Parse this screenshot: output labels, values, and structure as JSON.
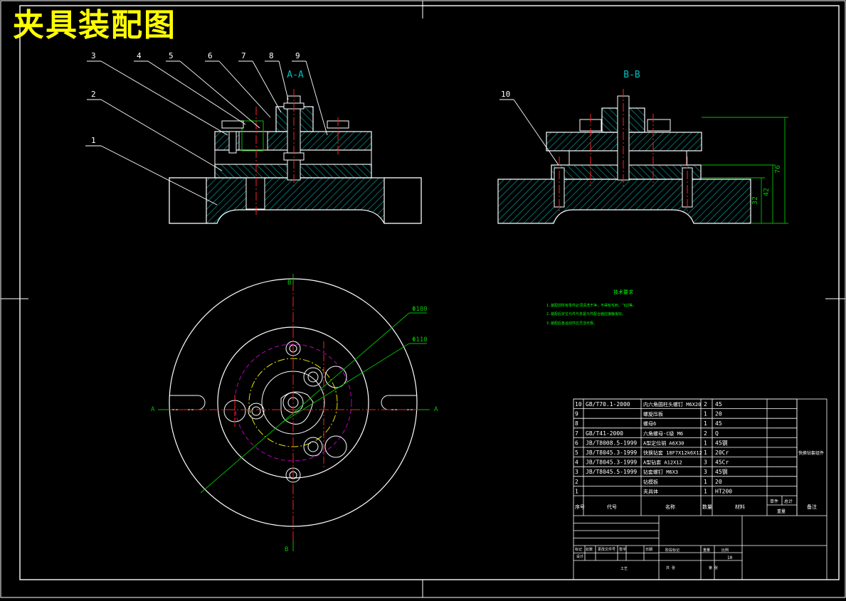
{
  "title": "夹具装配图",
  "colors": {
    "background": "#000000",
    "outline": "#ffffff",
    "title": "#ffff00",
    "hatch": "#00b3b3",
    "center_line": "#ff2020",
    "dimension": "#00c000",
    "tech_notes": "#00ff00",
    "pitch_circle": "#c000c0",
    "arc_yellow": "#e6e600"
  },
  "section_aa": {
    "label": "A-A"
  },
  "section_bb": {
    "label": "B-B"
  },
  "balloons": {
    "b1": "1",
    "b2": "2",
    "b3": "3",
    "b4": "4",
    "b5": "5",
    "b6": "6",
    "b7": "7",
    "b8": "8",
    "b9": "9",
    "b10": "10"
  },
  "dimensions": {
    "d1": "76",
    "d2": "42",
    "d3": "32",
    "dia1": "Φ180",
    "dia2": "Φ110"
  },
  "cut_marks": {
    "a_left": "A",
    "a_right": "A",
    "b_top": "B",
    "b_bottom": "B"
  },
  "tech_notes": {
    "title": "技术要求",
    "lines": [
      "1.装配前所有零件必须清洗干净，不得有毛刺、飞边等。",
      "2.装配后定位元件与夹紧元件配合面应接触良好。",
      "3.装配后各运动件应灵活可靠。"
    ]
  },
  "bom": {
    "rows": [
      {
        "no": "10",
        "code": "GB/T70.1-2000",
        "name": "内六角圆柱头螺钉 M6X20",
        "qty": "2",
        "mat": "45"
      },
      {
        "no": "9",
        "code": "",
        "name": "螺旋压板",
        "qty": "1",
        "mat": "20"
      },
      {
        "no": "8",
        "code": "",
        "name": "螺母6",
        "qty": "1",
        "mat": "45"
      },
      {
        "no": "7",
        "code": "GB/T41-2000",
        "name": "六角螺母-C级 M6",
        "qty": "2",
        "mat": "Q"
      },
      {
        "no": "6",
        "code": "JB/T8008.5-1999",
        "name": "A型定位销 A6X30",
        "qty": "1",
        "mat": "45钢"
      },
      {
        "no": "5",
        "code": "JB/T8045.3-1999",
        "name": "快换钻套 18F7X12k6X12",
        "qty": "1",
        "mat": "20Cr",
        "note": "快换钻套组件"
      },
      {
        "no": "4",
        "code": "JB/T8045.3-1999",
        "name": "A型钻套 A12X12",
        "qty": "3",
        "mat": "45Cr"
      },
      {
        "no": "3",
        "code": "JB/T8045.5-1999",
        "name": "钻套螺钉 M6X3",
        "qty": "3",
        "mat": "45钢"
      },
      {
        "no": "2",
        "code": "",
        "name": "钻模板",
        "qty": "1",
        "mat": "20"
      },
      {
        "no": "1",
        "code": "",
        "name": "夹具体",
        "qty": "1",
        "mat": "HT200"
      }
    ],
    "headers": {
      "no": "序号",
      "code": "代号",
      "name": "名称",
      "qty": "数量",
      "mat": "材料",
      "single": "单件",
      "total": "总计",
      "weight": "重量",
      "note": "备注"
    },
    "scale_value": "10",
    "title_labels": {
      "mark": "标记",
      "zones": "处数",
      "change_doc": "更改文件号",
      "sign": "签字",
      "date": "日期",
      "design": "设计",
      "review": "审核",
      "craft": "工艺",
      "stage": "阶段标记",
      "weight": "重量",
      "scale": "比例",
      "sheet_total": "共 张",
      "sheet": "第 张"
    }
  }
}
